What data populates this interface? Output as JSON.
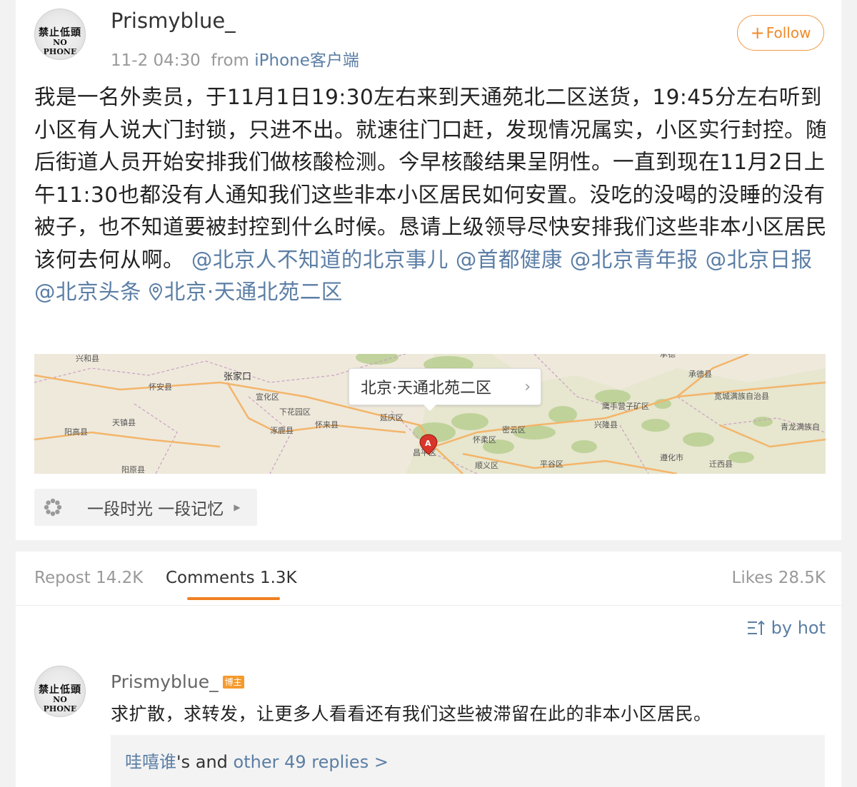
{
  "post": {
    "author": "Prismyblue_",
    "avatar_text_top": "禁止低頭",
    "avatar_text_bottom": "NO PHONE",
    "time": "11-2 04:30",
    "from_label": "from",
    "source": "iPhone客户端",
    "follow_label": "Follow",
    "body_text": "我是一名外卖员，于11月1日19:30左右来到天通苑北二区送货，19:45分左右听到小区有人说大门封锁，只进不出。就速往门口赶，发现情况属实，小区实行封控。随后街道人员开始安排我们做核酸检测。今早核酸结果呈阴性。一直到现在11月2日上午11:30也都没有人通知我们这些非本小区居民如何安置。没吃的没喝的没睡的没有被子，也不知道要被封控到什么时候。恳请上级领导尽快安排我们这些非本小区居民该何去何从啊。",
    "mentions": [
      "@北京人不知道的北京事儿",
      "@首都健康",
      "@北京青年报",
      "@北京日报",
      "@北京头条"
    ],
    "location_icon": "location-pin-icon",
    "location": "北京·天通北苑二区",
    "map": {
      "label": "北京·天通北苑二区",
      "marker": "A",
      "places": [
        "兴和县",
        "张家口",
        "怀安县",
        "宣化区",
        "下花园区",
        "怀来县",
        "延庆区",
        "涿鹿县",
        "阳高县",
        "天镇县",
        "阳原县",
        "昌平区",
        "怀柔区",
        "密云区",
        "顺义区",
        "平谷区",
        "承德县",
        "宽城满族自治县",
        "鹰手营子矿区",
        "兴隆县",
        "青龙满族自",
        "遵化市",
        "迁西县",
        "承德"
      ]
    },
    "topic": "一段时光 一段记忆"
  },
  "tabs": {
    "repost": "Repost 14.2K",
    "comments": "Comments 1.3K",
    "likes": "Likes 28.5K"
  },
  "sort_label": "by hot",
  "comment": {
    "author": "Prismyblue_",
    "badge": "博主",
    "text": "求扩散，求转发，让更多人看看还有我们这些被滞留在此的非本小区居民。",
    "replies_user": "哇嘻谁",
    "replies_mid": "'s and ",
    "replies_more": "other 49 replies >"
  },
  "colors": {
    "accent_orange": "#f07f22",
    "link_blue": "#5b7ea5"
  }
}
